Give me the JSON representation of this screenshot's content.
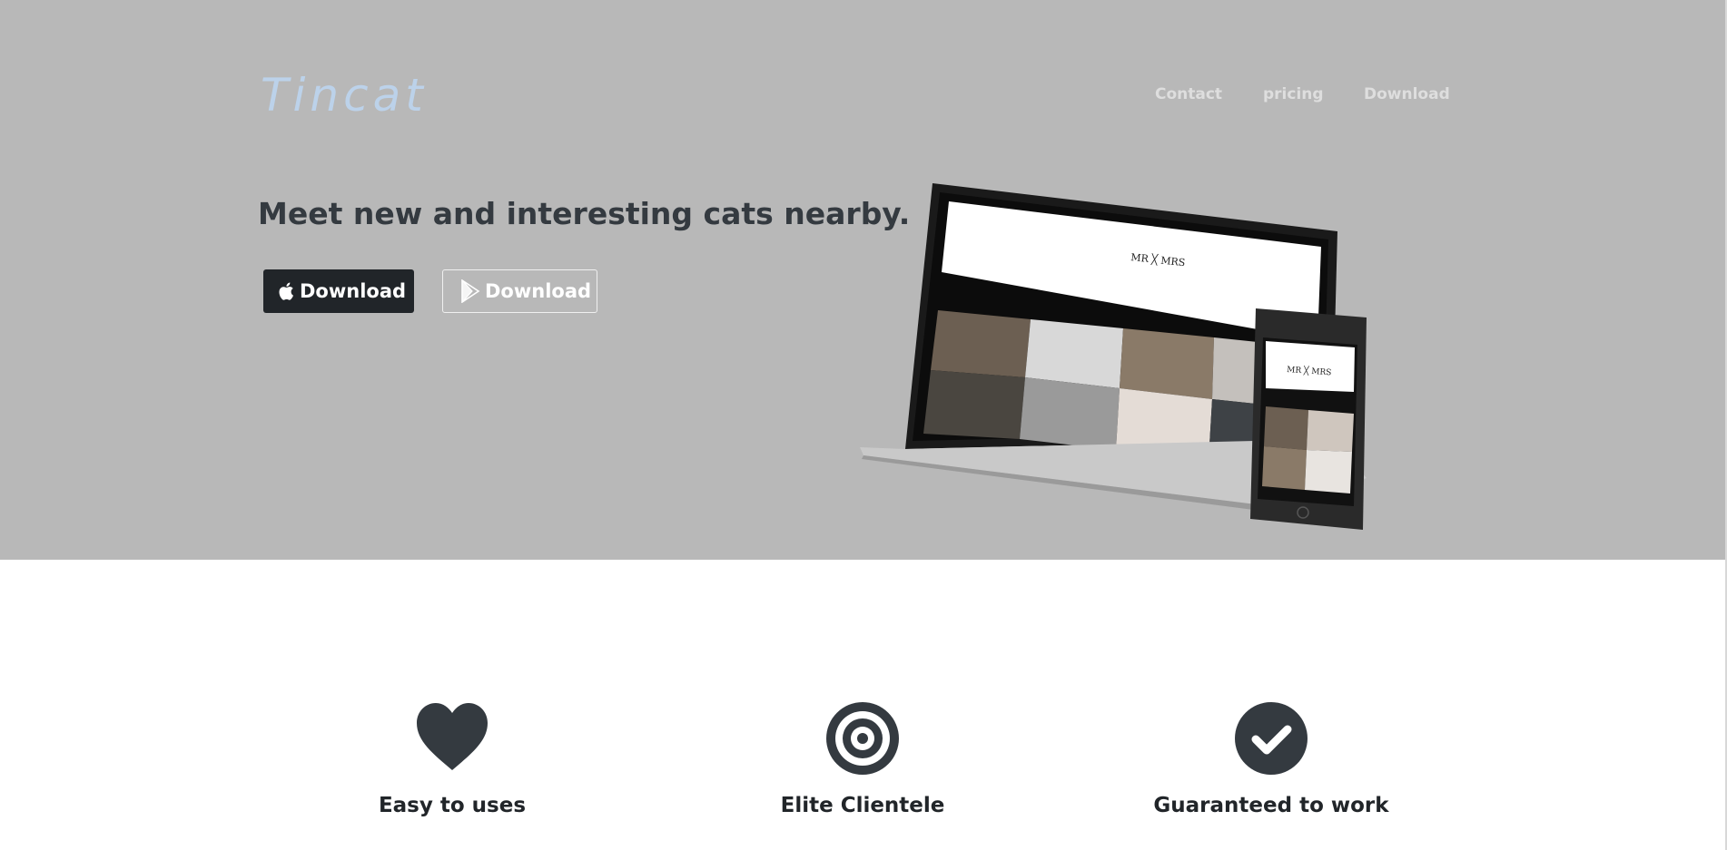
{
  "brand": "Tincat",
  "nav": {
    "contact": "Contact",
    "pricing": "pricing",
    "download": "Download"
  },
  "hero": {
    "headline": "Meet new and interesting cats nearby.",
    "apple_button": "Download",
    "google_button": "Download",
    "mockup_logo_laptop": "MR ╳ MRS",
    "mockup_logo_phone": "MR ╳ MRS"
  },
  "features": [
    {
      "icon": "heart-icon",
      "title": "Easy to uses",
      "text": ""
    },
    {
      "icon": "target-icon",
      "title": "Elite Clientele",
      "text": ""
    },
    {
      "icon": "check-circle-icon",
      "title": "Guaranteed to work",
      "text": ""
    }
  ],
  "colors": {
    "hero_bg": "#b8b8b8",
    "brand": "#bcd2ea",
    "dark": "#343a40",
    "button_dark": "#212529"
  }
}
